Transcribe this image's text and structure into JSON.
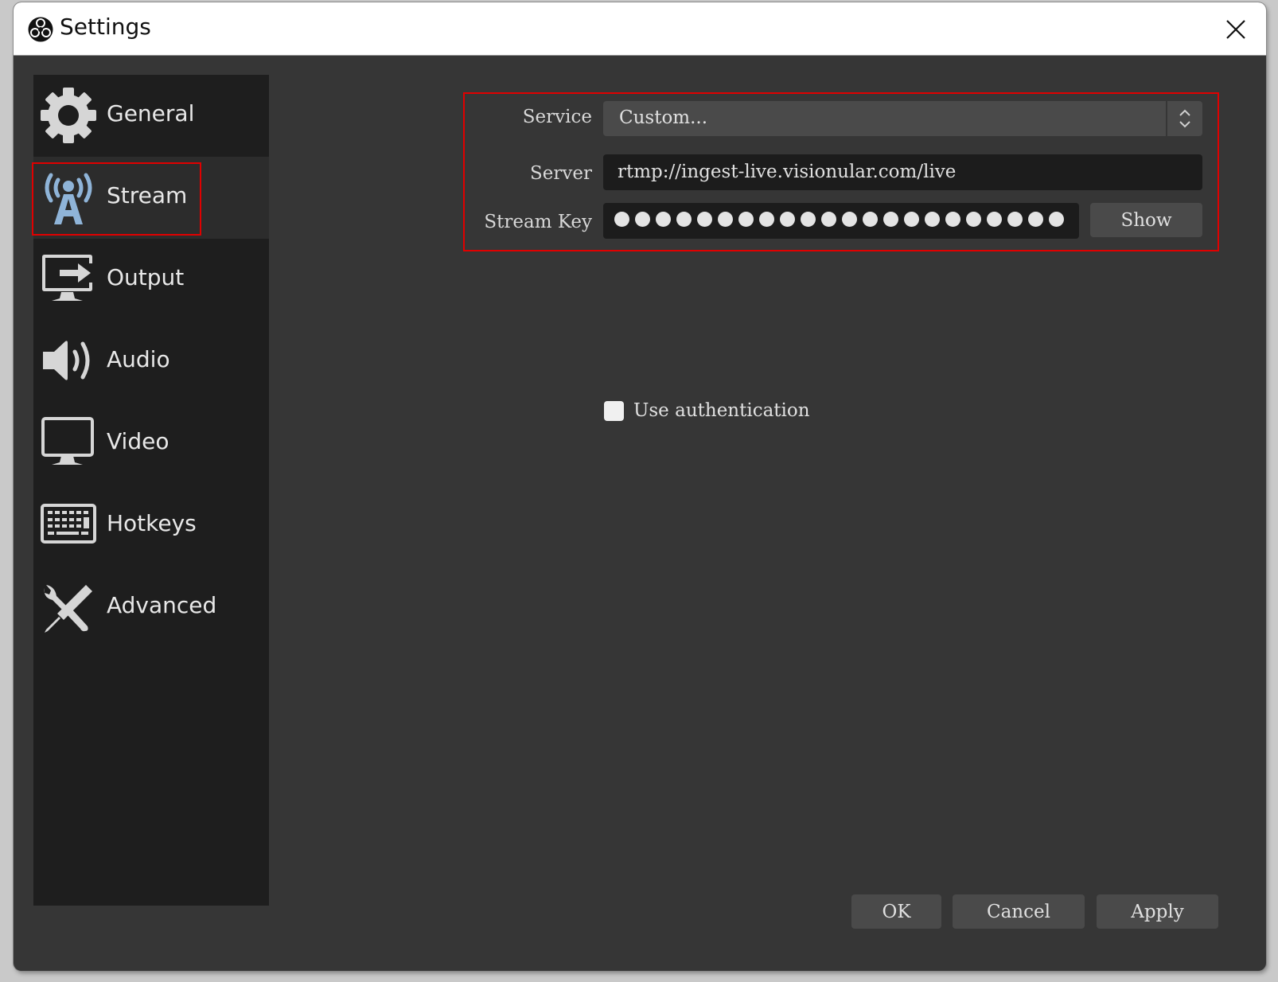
{
  "window": {
    "title": "Settings",
    "logo_icon": "obs-logo-icon",
    "close_icon": "close-icon"
  },
  "sidebar": {
    "items": [
      {
        "label": "General",
        "icon": "gear-icon",
        "active": false
      },
      {
        "label": "Stream",
        "icon": "broadcast-tower-icon",
        "active": true
      },
      {
        "label": "Output",
        "icon": "monitor-output-icon",
        "active": false
      },
      {
        "label": "Audio",
        "icon": "speaker-icon",
        "active": false
      },
      {
        "label": "Video",
        "icon": "monitor-icon",
        "active": false
      },
      {
        "label": "Hotkeys",
        "icon": "keyboard-icon",
        "active": false
      },
      {
        "label": "Advanced",
        "icon": "tools-icon",
        "active": false
      }
    ]
  },
  "stream": {
    "service_label": "Service",
    "service_value": "Custom...",
    "server_label": "Server",
    "server_value": "rtmp://ingest-live.visionular.com/live",
    "stream_key_label": "Stream Key",
    "stream_key_masked_length": 22,
    "show_button": "Show",
    "use_auth_label": "Use authentication",
    "use_auth_checked": false
  },
  "footer": {
    "ok": "OK",
    "cancel": "Cancel",
    "apply": "Apply"
  },
  "colors": {
    "highlight": "#e00000",
    "active_icon": "#8fb4d8",
    "icon": "#d6d6d6"
  }
}
